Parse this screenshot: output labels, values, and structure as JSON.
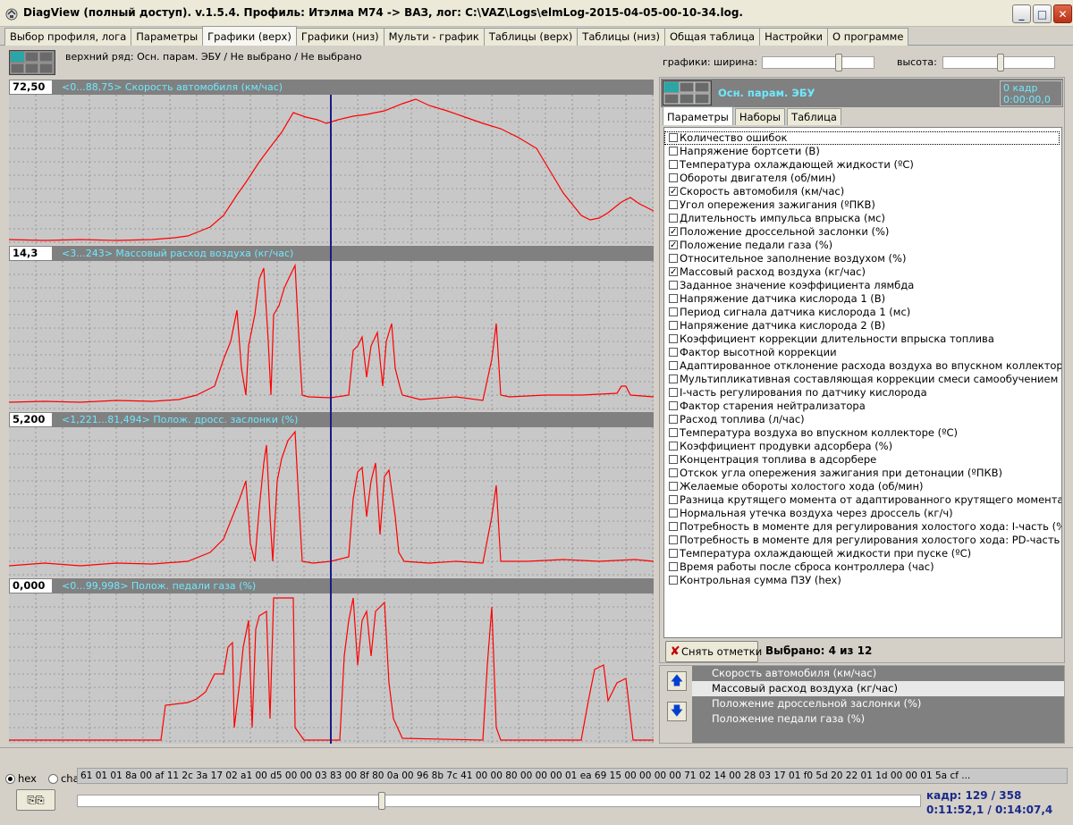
{
  "window": {
    "title": "DiagView (полный доступ). v.1.5.4. Профиль: Итэлма M74 -> ВАЗ,   лог: C:\\VAZ\\Logs\\elmLog-2015-04-05-00-10-34.log.",
    "app_icon": "diagview-icon",
    "minimize": "_",
    "maximize": "□",
    "close": "✕"
  },
  "tabs": [
    {
      "label": "Выбор профиля, лога",
      "active": false
    },
    {
      "label": "Параметры",
      "active": false
    },
    {
      "label": "Графики (верх)",
      "active": true
    },
    {
      "label": "Графики (низ)",
      "active": false
    },
    {
      "label": "Мульти - график",
      "active": false
    },
    {
      "label": "Таблицы (верх)",
      "active": false
    },
    {
      "label": "Таблицы (низ)",
      "active": false
    },
    {
      "label": "Общая таблица",
      "active": false
    },
    {
      "label": "Настройки",
      "active": false
    },
    {
      "label": "О программе",
      "active": false
    }
  ],
  "toolbar": {
    "top_row_label": "верхний ряд: Осн. парам. ЭБУ / Не выбрано / Не выбрано",
    "graphs_label": "графики:  ширина:",
    "height_label": "высота:",
    "width_slider": 0.7,
    "height_slider": 0.52
  },
  "panels": [
    {
      "value": "72,50",
      "caption": "<0...88,75> Скорость автомобиля (км/час)"
    },
    {
      "value": "14,3",
      "caption": "<3...243> Массовый расход воздуха (кг/час)"
    },
    {
      "value": "5,200",
      "caption": "<1,221...81,494> Полож. дросс. заслонки (%)"
    },
    {
      "value": "0,000",
      "caption": "<0...99,998> Полож. педали газа (%)"
    }
  ],
  "colors": {
    "trace": "#ff0000",
    "cursor": "#1a1a8a",
    "caption": "#6fe8ff",
    "grid_bg": "#c8c8c8",
    "header_bg": "#808080"
  },
  "right_panel": {
    "set_title": "Осн. парам. ЭБУ",
    "frame_box_line1": "0 кадр",
    "frame_box_line2": "0:00:00,0",
    "tabs": [
      {
        "label": "Параметры",
        "active": true
      },
      {
        "label": "Наборы",
        "active": false
      },
      {
        "label": "Таблица",
        "active": false
      }
    ],
    "params": [
      {
        "label": "Количество ошибок",
        "checked": false
      },
      {
        "label": "Напряжение бортсети (В)",
        "checked": false
      },
      {
        "label": "Температура охлаждающей жидкости (ºС)",
        "checked": false
      },
      {
        "label": "Обороты двигателя (об/мин)",
        "checked": false
      },
      {
        "label": "Скорость автомобиля (км/час)",
        "checked": true
      },
      {
        "label": "Угол опережения зажигания (ºПКВ)",
        "checked": false
      },
      {
        "label": "Длительность импульса впрыска (мс)",
        "checked": false
      },
      {
        "label": "Положение дроссельной заслонки (%)",
        "checked": true
      },
      {
        "label": "Положение педали газа (%)",
        "checked": true
      },
      {
        "label": "Относительное заполнение воздухом (%)",
        "checked": false
      },
      {
        "label": "Массовый расход воздуха (кг/час)",
        "checked": true
      },
      {
        "label": "Заданное значение коэффициента лямбда",
        "checked": false
      },
      {
        "label": "Напряжение датчика кислорода 1 (В)",
        "checked": false
      },
      {
        "label": "Период сигнала датчика кислорода 1 (мс)",
        "checked": false
      },
      {
        "label": "Напряжение датчика кислорода 2 (В)",
        "checked": false
      },
      {
        "label": "Коэффициент коррекции длительности впрыска топлива",
        "checked": false
      },
      {
        "label": "Фактор высотной коррекции",
        "checked": false
      },
      {
        "label": "Адаптированное отклонение расхода воздуха во впускном коллекторе мимо",
        "checked": false
      },
      {
        "label": "Мультипликативная составляющая коррекции смеси самообучением",
        "checked": false
      },
      {
        "label": "I-часть регулирования по датчику кислорода",
        "checked": false
      },
      {
        "label": "Фактор старения нейтрализатора",
        "checked": false
      },
      {
        "label": "Расход топлива (л/час)",
        "checked": false
      },
      {
        "label": "Температура воздуха во впускном коллекторе (ºС)",
        "checked": false
      },
      {
        "label": "Коэффициент продувки адсорбера (%)",
        "checked": false
      },
      {
        "label": "Концентрация топлива в адсорбере",
        "checked": false
      },
      {
        "label": "Отскок угла опережения зажигания при детонации (ºПКВ)",
        "checked": false
      },
      {
        "label": "Желаемые обороты холостого хода (об/мин)",
        "checked": false
      },
      {
        "label": "Разница крутящего момента от адаптированного крутящего момента (%)",
        "checked": false
      },
      {
        "label": "Нормальная утечка воздуха через дроссель (кг/ч)",
        "checked": false
      },
      {
        "label": "Потребность в моменте для регулирования холостого хода: I-часть (%)",
        "checked": false
      },
      {
        "label": "Потребность в моменте для регулирования холостого хода: PD-часть (%)",
        "checked": false
      },
      {
        "label": "Температура охлаждающей жидкости при пуске (ºС)",
        "checked": false
      },
      {
        "label": "Время работы после сброса контроллера (час)",
        "checked": false
      },
      {
        "label": "Контрольная сумма ПЗУ (hex)",
        "checked": false
      }
    ],
    "clear_label": "Снять отметки",
    "selected_label": "Выбрано: 4 из 12",
    "order": [
      {
        "label": "Скорость автомобиля (км/час)",
        "selected": false
      },
      {
        "label": "Массовый расход воздуха (кг/час)",
        "selected": true
      },
      {
        "label": "Положение дроссельной заслонки (%)",
        "selected": false
      },
      {
        "label": "Положение педали газа (%)",
        "selected": false
      }
    ]
  },
  "bottom": {
    "hex_label": "hex",
    "char_label": "char",
    "hex_data": "61 01 01 8a 00 af 11 2c 3a 17 02 a1 00 d5 00 00 03 83 00 8f 80 0a 00 96 8b 7c 41 00 00 80 00 00 00 01 ea 69 15 00 00 00 00 71 02 14 00 28 03 17 01 f0 5d 20 22 01 1d 00 00 01 5a cf ...",
    "frame_counter": "кадр: 129 / 358",
    "time_counter": "0:11:52,1 / 0:14:07,4",
    "scrub_position": 0.36
  }
}
